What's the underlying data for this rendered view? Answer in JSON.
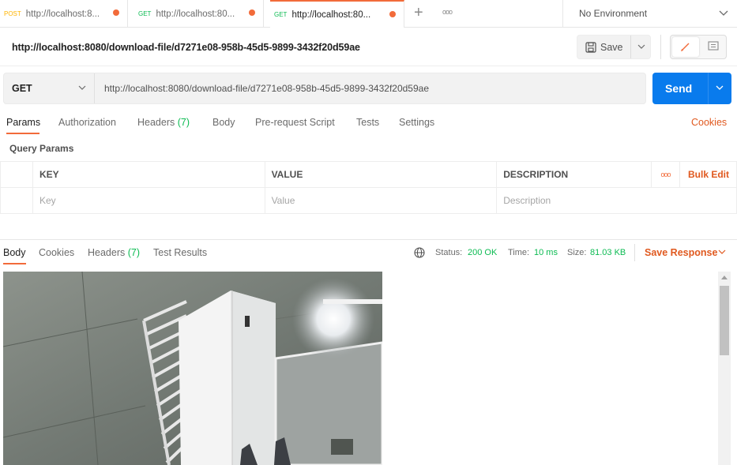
{
  "tabs": [
    {
      "method": "POST",
      "method_color": "#ffb400",
      "url": "http://localhost:8..."
    },
    {
      "method": "GET",
      "method_color": "#0cbb52",
      "url": "http://localhost:80..."
    },
    {
      "method": "GET",
      "method_color": "#0cbb52",
      "url": "http://localhost:80..."
    }
  ],
  "new_tab_glyph": "+",
  "more_glyph": "ooo",
  "environment": "No Environment",
  "request_title": "http://localhost:8080/download-file/d7271e08-958b-45d5-9899-3432f20d59ae",
  "save_label": "Save",
  "method": "GET",
  "url": "http://localhost:8080/download-file/d7271e08-958b-45d5-9899-3432f20d59ae",
  "send_label": "Send",
  "request_tabs": {
    "params": "Params",
    "authorization": "Authorization",
    "headers": "Headers",
    "headers_count": "(7)",
    "body": "Body",
    "prerequest": "Pre-request Script",
    "tests": "Tests",
    "settings": "Settings",
    "cookies": "Cookies"
  },
  "query_params_label": "Query Params",
  "params_table": {
    "headers": [
      "KEY",
      "VALUE",
      "DESCRIPTION"
    ],
    "bulk_edit": "Bulk Edit",
    "placeholders": [
      "Key",
      "Value",
      "Description"
    ]
  },
  "response_tabs": {
    "body": "Body",
    "cookies": "Cookies",
    "headers": "Headers",
    "headers_count": "(7)",
    "test_results": "Test Results"
  },
  "status": {
    "status_label": "Status:",
    "status_value": "200 OK",
    "time_label": "Time:",
    "time_value": "10 ms",
    "size_label": "Size:",
    "size_value": "81.03 KB"
  },
  "save_response_label": "Save Response",
  "accent_color": "#f26b3a",
  "send_color": "#097bed"
}
